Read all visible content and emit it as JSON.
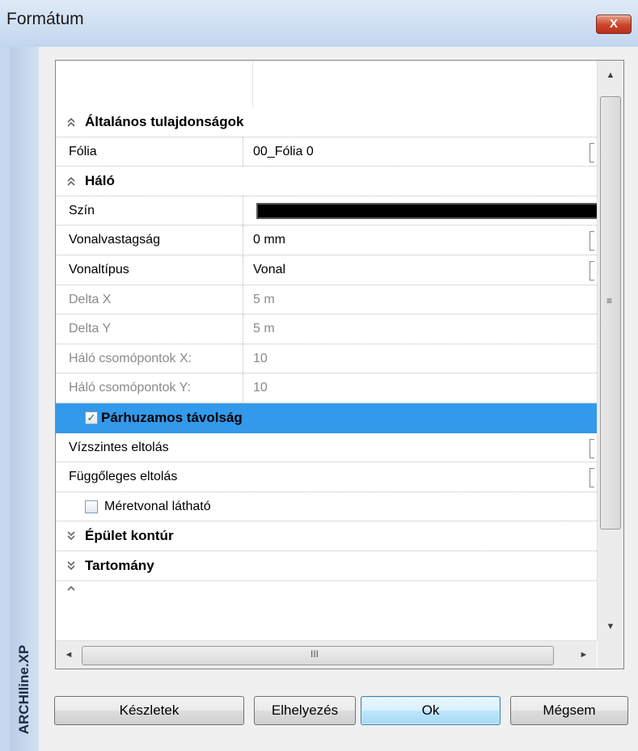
{
  "window": {
    "title": "Formátum",
    "close_symbol": "X",
    "side_label": "ARCHIline.XP"
  },
  "grid": {
    "categories": {
      "general": {
        "label": "Általános tulajdonságok",
        "icon": "collapse-chevron-icon"
      },
      "grid": {
        "label": "Háló",
        "icon": "collapse-chevron-icon"
      },
      "parallel": {
        "label": "Párhuzamos távolság",
        "checked": true
      },
      "building_outline": {
        "label": "Épület kontúr",
        "icon": "expand-chevron-icon"
      },
      "range": {
        "label": "Tartomány",
        "icon": "expand-chevron-icon"
      }
    },
    "rows": {
      "folia": {
        "name": "Fólia",
        "value": "00_Fólia 0"
      },
      "szin": {
        "name": "Szín",
        "color": "#000000"
      },
      "vonalvastagsag": {
        "name": "Vonalvastagság",
        "value": "0 mm"
      },
      "vonaltipus": {
        "name": "Vonaltípus",
        "value": "Vonal"
      },
      "delta_x": {
        "name": "Delta X",
        "value": "5 m"
      },
      "delta_y": {
        "name": "Delta Y",
        "value": "5 m"
      },
      "nodes_x": {
        "name": "Háló csomópontok X:",
        "value": "10"
      },
      "nodes_y": {
        "name": "Háló csomópontok Y:",
        "value": "10"
      },
      "horizontal_offset": {
        "name": "Vízszintes eltolás"
      },
      "vertical_offset": {
        "name": "Függőleges eltolás"
      },
      "dimension_visible": {
        "name": "Méretvonal látható",
        "checked": false
      }
    },
    "scrollbars": {
      "up": "▲",
      "down": "▼",
      "left": "◄",
      "right": "►",
      "grip": "III"
    }
  },
  "buttons": {
    "presets": "Készletek",
    "placement": "Elhelyezés",
    "ok": "Ok",
    "cancel": "Mégsem"
  },
  "colors": {
    "selection": "#3399ea",
    "title_gradient_top": "#dfeaf7",
    "close_red": "#c9452a"
  }
}
